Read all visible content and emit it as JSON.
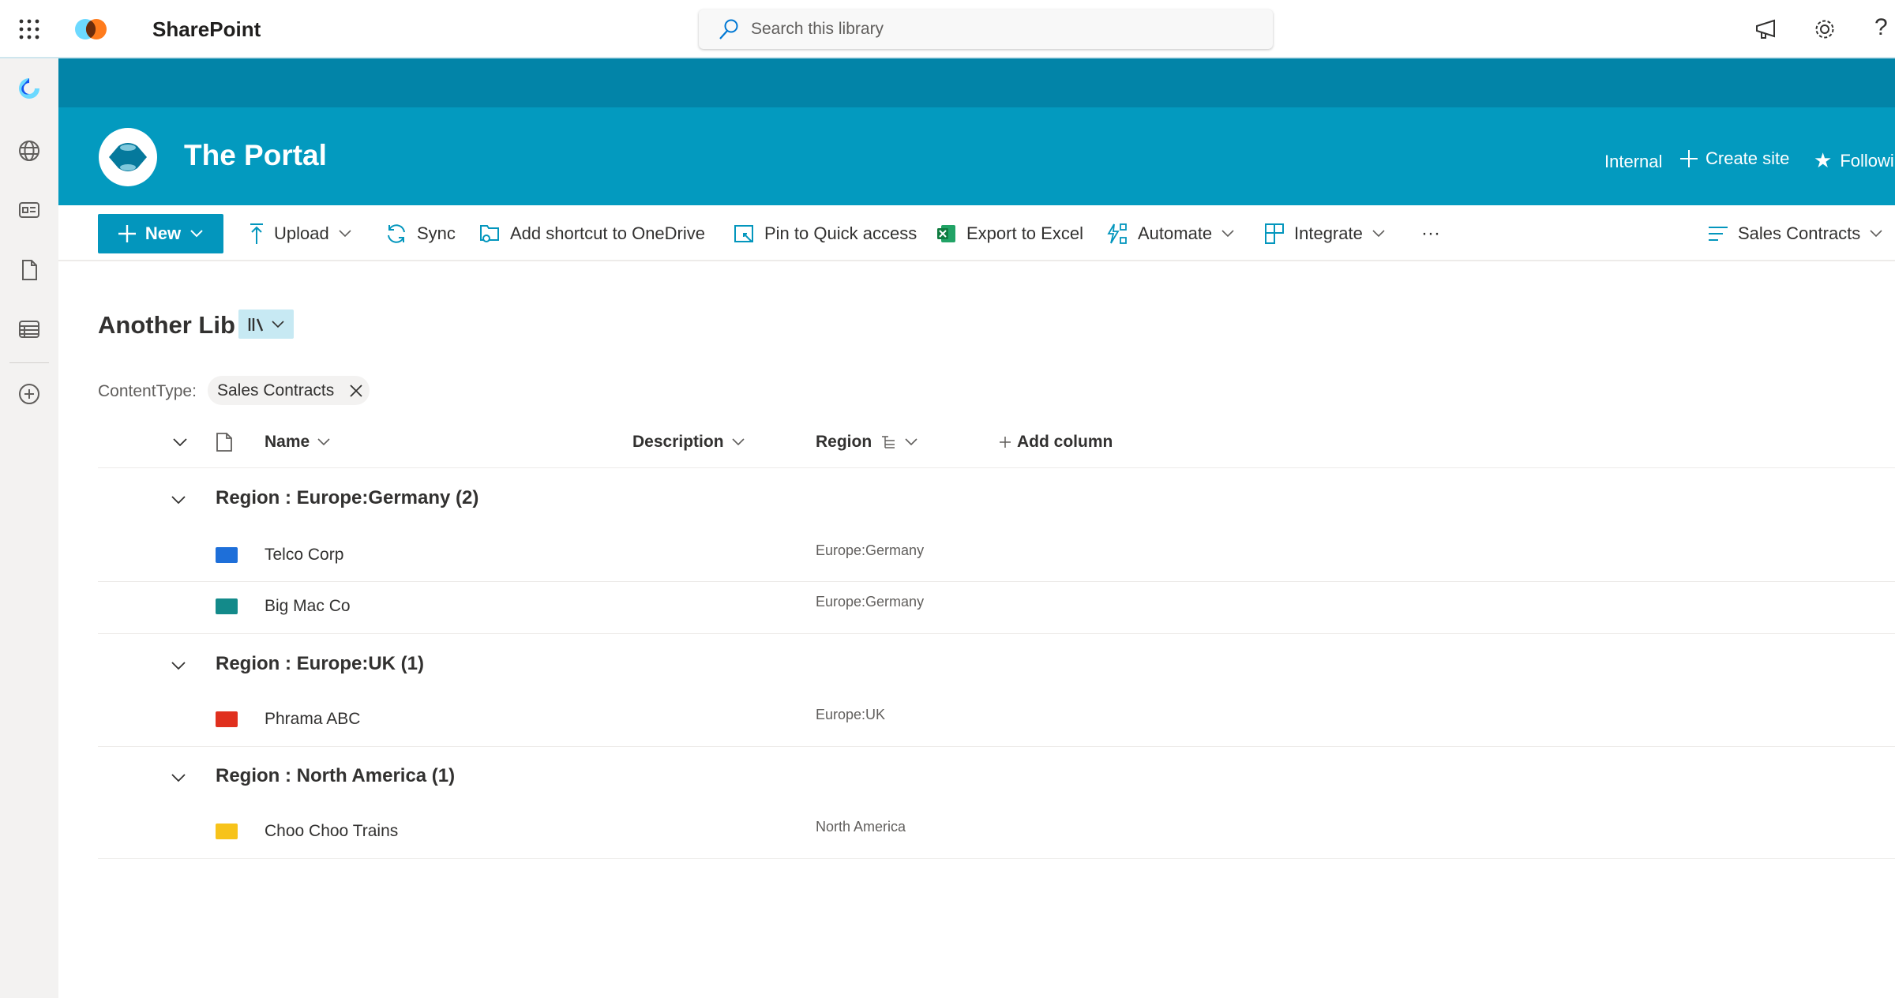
{
  "suite": {
    "app_name": "SharePoint",
    "search_placeholder": "Search this library"
  },
  "site": {
    "title": "The Portal",
    "classification": "Internal",
    "create_site": "Create site",
    "following": "Followi"
  },
  "commands": {
    "new": "New",
    "upload": "Upload",
    "sync": "Sync",
    "add_shortcut": "Add shortcut to OneDrive",
    "pin": "Pin to Quick access",
    "export": "Export to Excel",
    "automate": "Automate",
    "integrate": "Integrate",
    "more": "···",
    "view": "Sales Contracts"
  },
  "library": {
    "title": "Another Lib",
    "filter_label": "ContentType:",
    "filter_value": "Sales Contracts"
  },
  "columns": {
    "name": "Name",
    "description": "Description",
    "region": "Region",
    "add": "Add column"
  },
  "groups": [
    {
      "label": "Region : Europe:Germany (2)",
      "items": [
        {
          "name": "Telco Corp",
          "region": "Europe:Germany",
          "color": "#1e6fd9"
        },
        {
          "name": "Big Mac Co",
          "region": "Europe:Germany",
          "color": "#138a8a"
        }
      ]
    },
    {
      "label": "Region : Europe:UK (1)",
      "items": [
        {
          "name": "Phrama ABC",
          "region": "Europe:UK",
          "color": "#e0301e"
        }
      ]
    },
    {
      "label": "Region : North America (1)",
      "items": [
        {
          "name": "Choo Choo Trains",
          "region": "North America",
          "color": "#f7c31a"
        }
      ]
    }
  ],
  "colors": {
    "accent": "#039abf",
    "band": "#0284a8",
    "new_button": "#0396bd"
  }
}
